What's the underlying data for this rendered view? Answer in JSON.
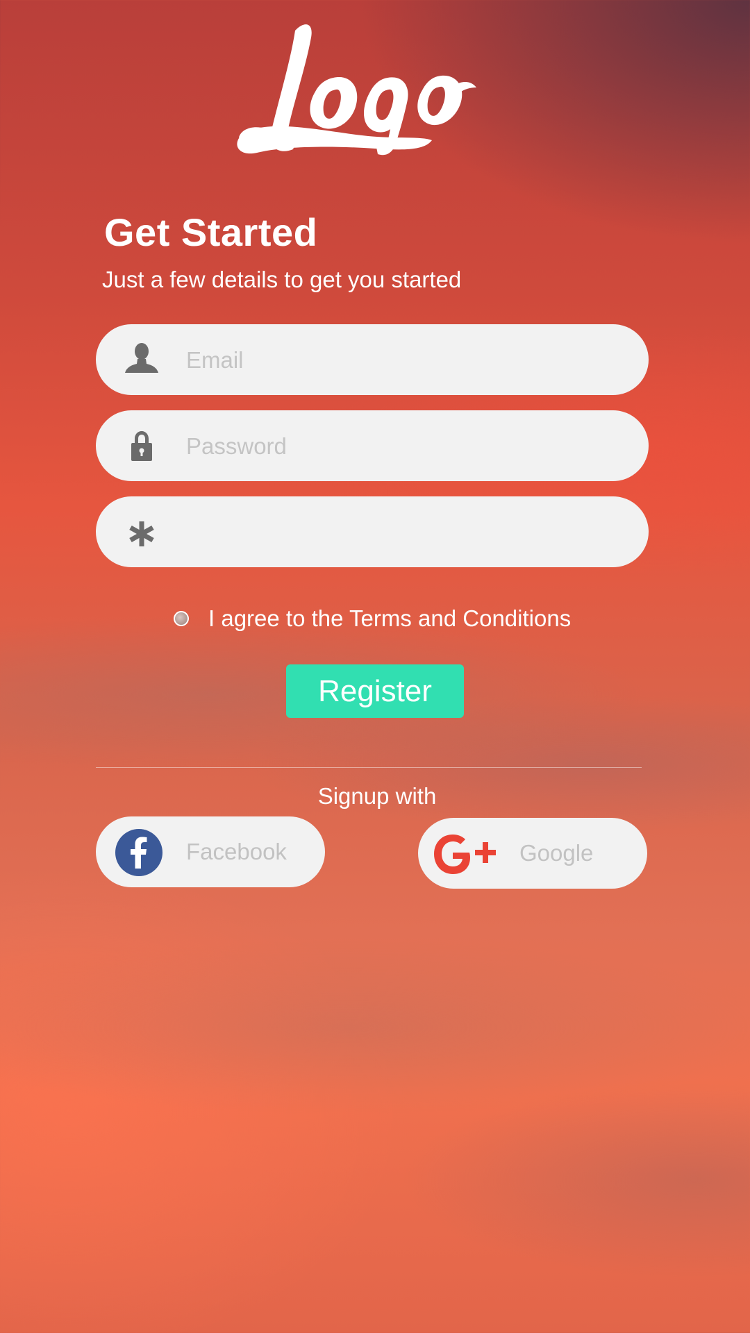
{
  "logo": {
    "text": "logo"
  },
  "header": {
    "title": "Get Started",
    "subtitle": "Just a few details to get you started"
  },
  "form": {
    "email_placeholder": "Email",
    "email_icon": "user-icon",
    "password_placeholder": "Password",
    "password_icon": "lock-icon",
    "extra_placeholder": "",
    "extra_icon": "asterisk-icon"
  },
  "terms": {
    "label": "I agree to the Terms and Conditions",
    "checked": false
  },
  "register": {
    "label": "Register"
  },
  "social": {
    "heading": "Signup with",
    "facebook_label": "Facebook",
    "google_label": "Google"
  },
  "colors": {
    "accent": "#31dfb1",
    "field_bg": "#f2f2f2",
    "facebook": "#3b5998",
    "google": "#ea4335",
    "icon_gray": "#6b6b6b"
  }
}
